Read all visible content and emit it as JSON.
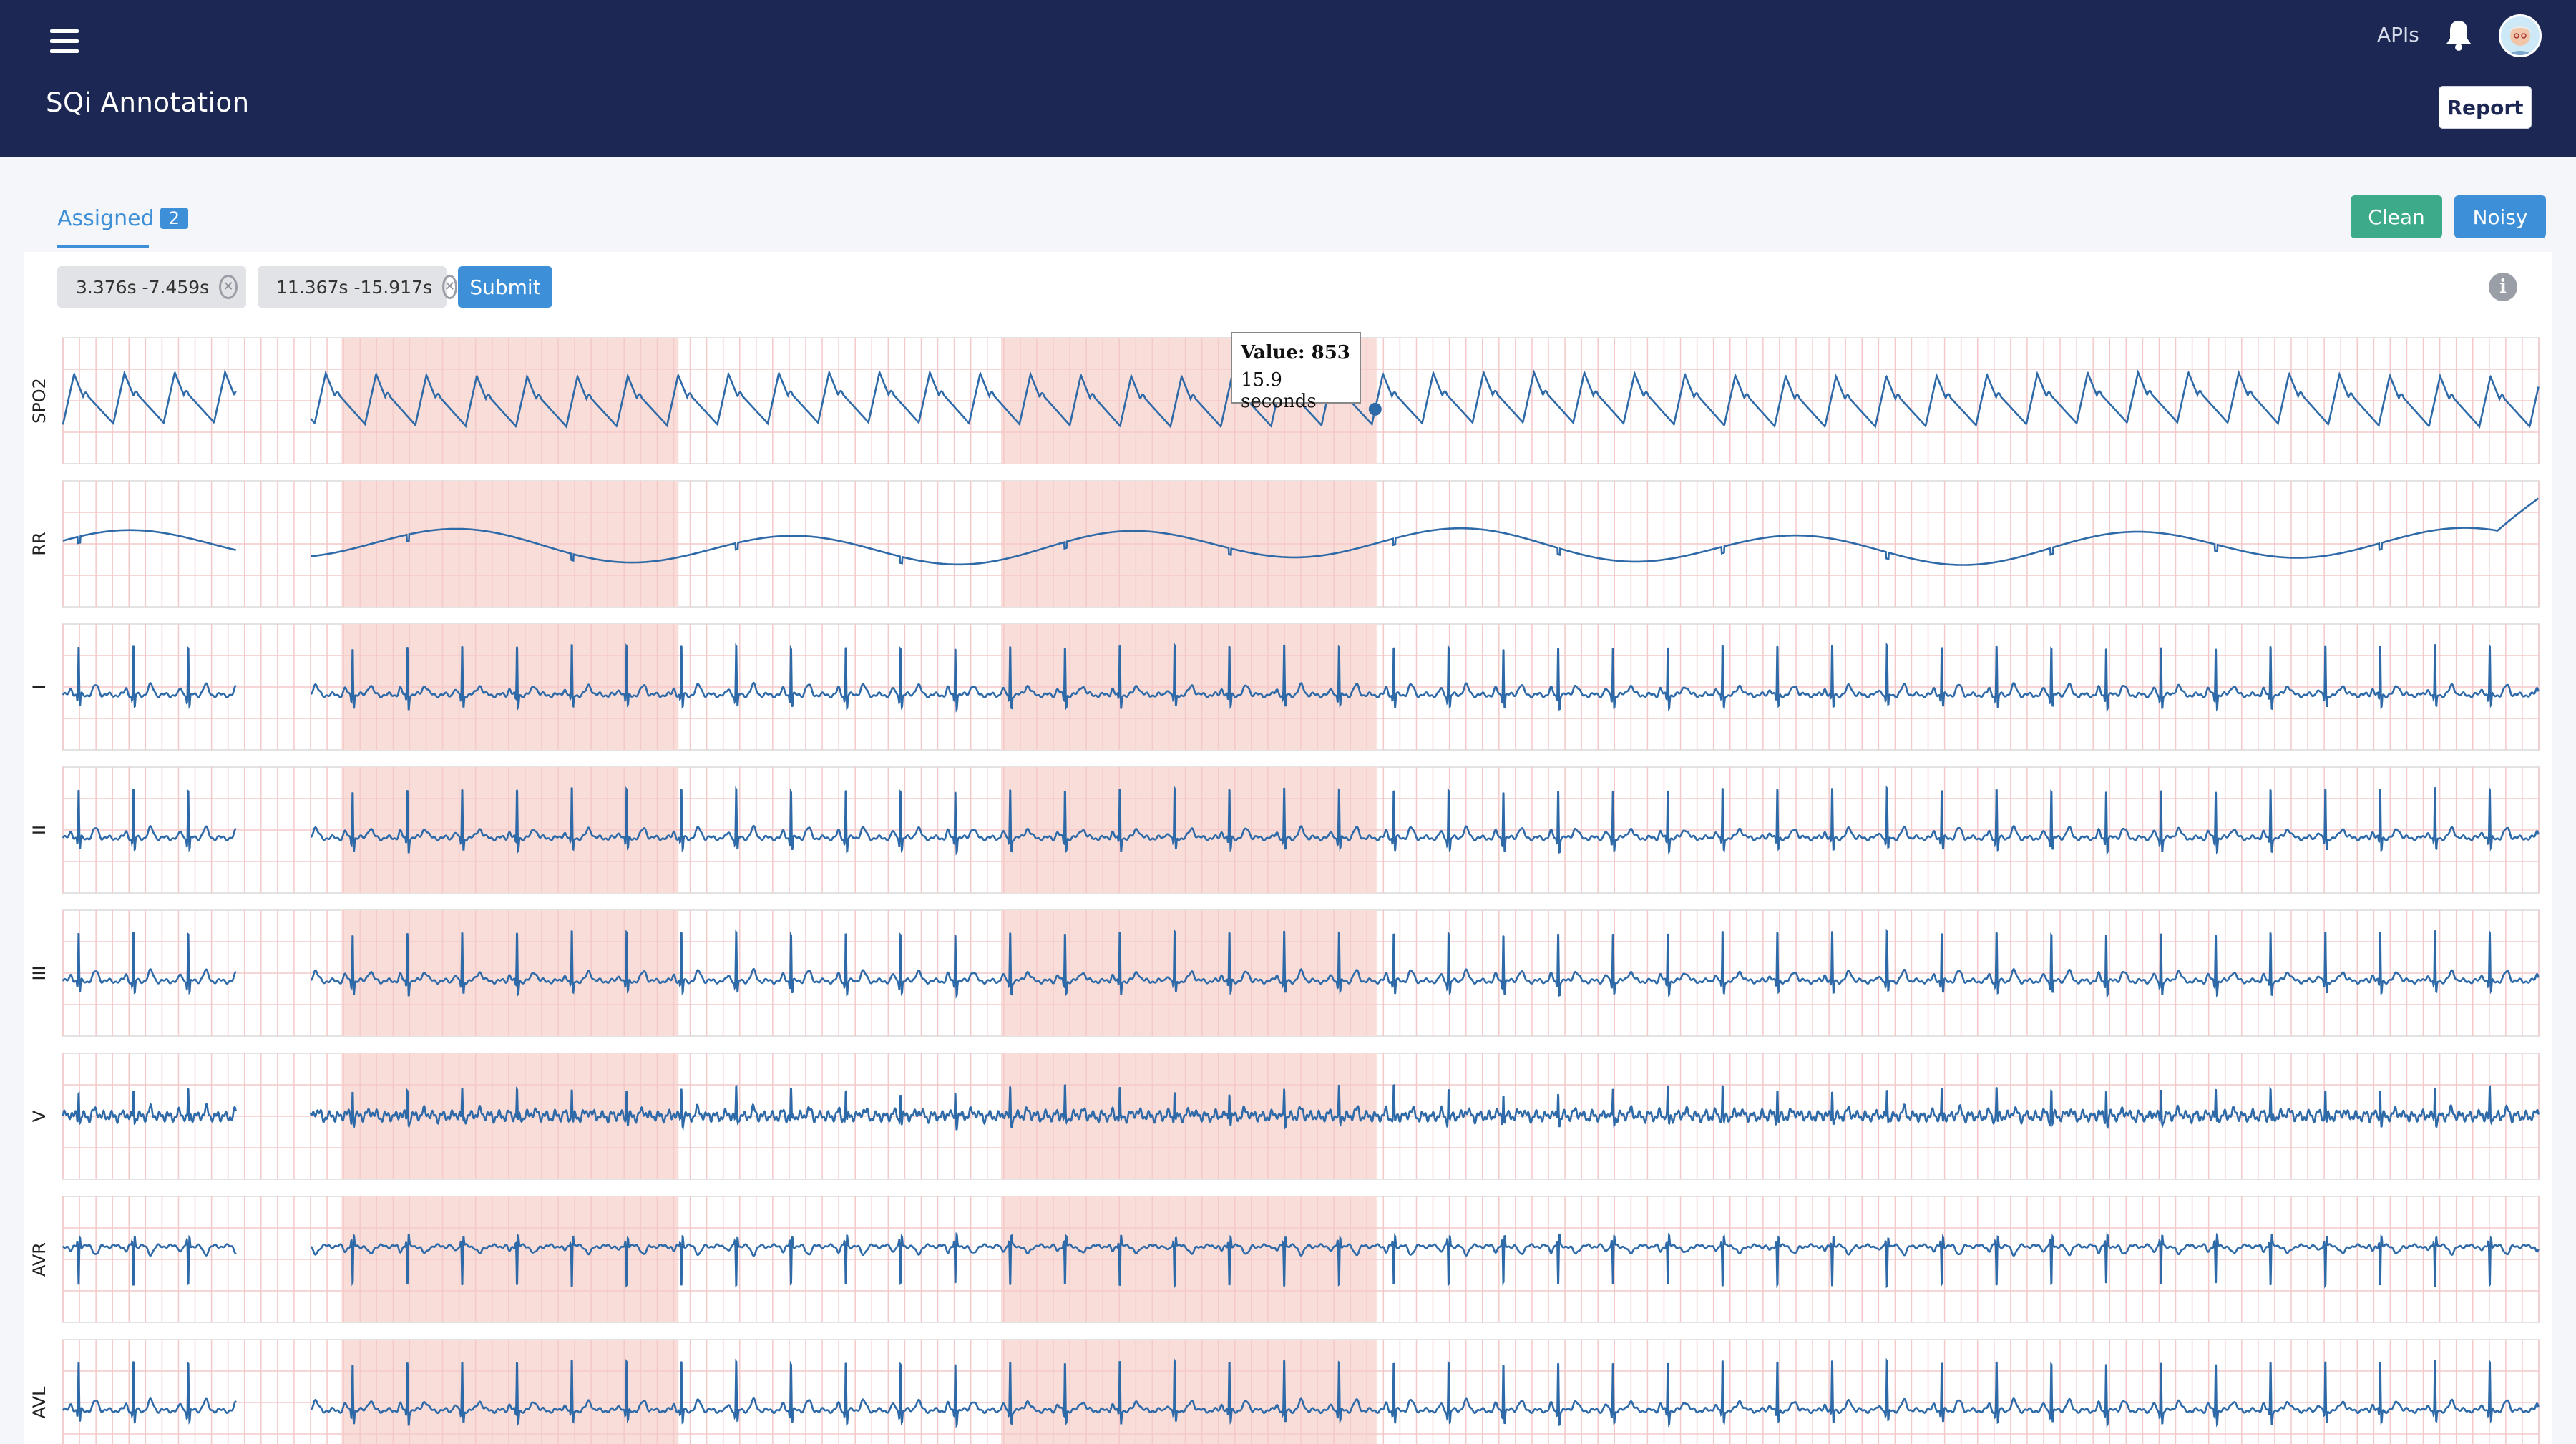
{
  "header": {
    "title": "SQi Annotation",
    "apis_label": "APIs",
    "report_label": "Report"
  },
  "tabs": {
    "assigned_label": "Assigned",
    "assigned_count": "2"
  },
  "actions": {
    "clean_label": "Clean",
    "noisy_label": "Noisy",
    "submit_label": "Submit"
  },
  "selections": [
    {
      "label": "3.376s -7.459s",
      "start": 3.376,
      "end": 7.459
    },
    {
      "label": "11.367s -15.917s",
      "start": 11.367,
      "end": 15.917
    }
  ],
  "tooltip": {
    "value_text": "Value: 853",
    "time_text": "15.9 seconds"
  },
  "colors": {
    "header_bg": "#1c2853",
    "accent_blue": "#3d8fd8",
    "clean_green": "#3daa89",
    "trace": "#2f6aa8",
    "grid": "#f4c9c9",
    "selection_fill": "#f9ddd8"
  },
  "chart_data": {
    "type": "line",
    "x_range_seconds": [
      0,
      30
    ],
    "gap_seconds": [
      2.1,
      3.0
    ],
    "channels": [
      {
        "name": "SPO2",
        "kind": "pleth"
      },
      {
        "name": "RR",
        "kind": "resp"
      },
      {
        "name": "I",
        "kind": "ecg"
      },
      {
        "name": "II",
        "kind": "ecg"
      },
      {
        "name": "III",
        "kind": "ecg"
      },
      {
        "name": "V",
        "kind": "ecg_noisy"
      },
      {
        "name": "AVR",
        "kind": "ecg_inverted"
      },
      {
        "name": "AVL",
        "kind": "ecg"
      }
    ],
    "selected_regions": [
      [
        3.376,
        7.459
      ],
      [
        11.367,
        15.917
      ]
    ],
    "hover_point": {
      "channel": "SPO2",
      "time": 15.9,
      "value": 853
    }
  }
}
